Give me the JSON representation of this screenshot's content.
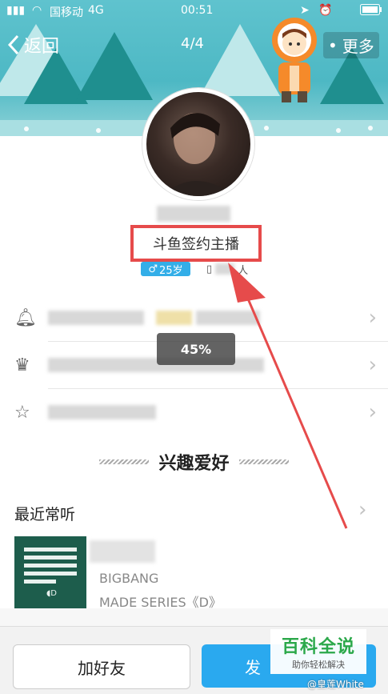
{
  "status_bar": {
    "carrier": "国移动",
    "network": "4G",
    "time": "00:51"
  },
  "nav": {
    "back_label": "返回",
    "page_indicator": "4/4",
    "more_label": "更多"
  },
  "profile": {
    "tag": "斗鱼签约主播",
    "age": "25岁",
    "device_suffix": "人"
  },
  "progress_overlay": {
    "label": "45%",
    "value_percent": 45
  },
  "section": {
    "interest_title": "兴趣爱好",
    "recent_label": "最近常听"
  },
  "music": {
    "title": "BIGBANG",
    "subtitle": "MADE SERIES《D》"
  },
  "actions": {
    "add_friend": "加好友",
    "send_partial": "发"
  },
  "watermark": {
    "main": "百科全说",
    "sub": "助你轻松解决",
    "weibo": "@皇莲White"
  },
  "colors": {
    "accent_blue": "#2aa9ef",
    "highlight_red": "#e64b4b",
    "banner_teal": "#4db8c4",
    "watermark_green": "#2ba84a"
  }
}
